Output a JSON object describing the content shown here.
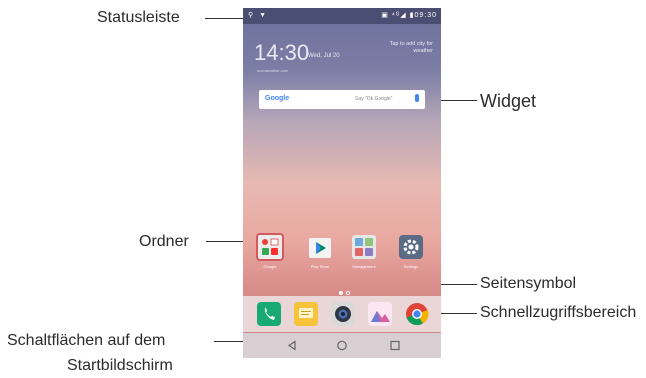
{
  "callouts": {
    "statusbar": "Statusleiste",
    "widget": "Widget",
    "folder": "Ordner",
    "page_indicator": "Seitensymbol",
    "quick_access": "Schnellzugriffsbereich",
    "home_buttons_line1": "Schaltflächen auf dem",
    "home_buttons_line2": "Startbildschirm"
  },
  "phone": {
    "status_time": "09:30",
    "clock_time": "14:30",
    "clock_date": "Wed, Jul 20",
    "weather_hint": "Tap to add city for weather",
    "weather_source": "accuweather.com",
    "search": {
      "logo": "Google",
      "hint": "Say \"Ok Google\""
    },
    "apps": [
      {
        "label": "Google"
      },
      {
        "label": "Play Store"
      },
      {
        "label": "Management"
      },
      {
        "label": "Settings"
      }
    ],
    "dock_icons": [
      "phone-icon",
      "messaging-icon",
      "camera-icon",
      "gallery-icon",
      "chrome-icon"
    ],
    "nav_icons": [
      "back-icon",
      "home-icon",
      "recents-icon"
    ]
  }
}
